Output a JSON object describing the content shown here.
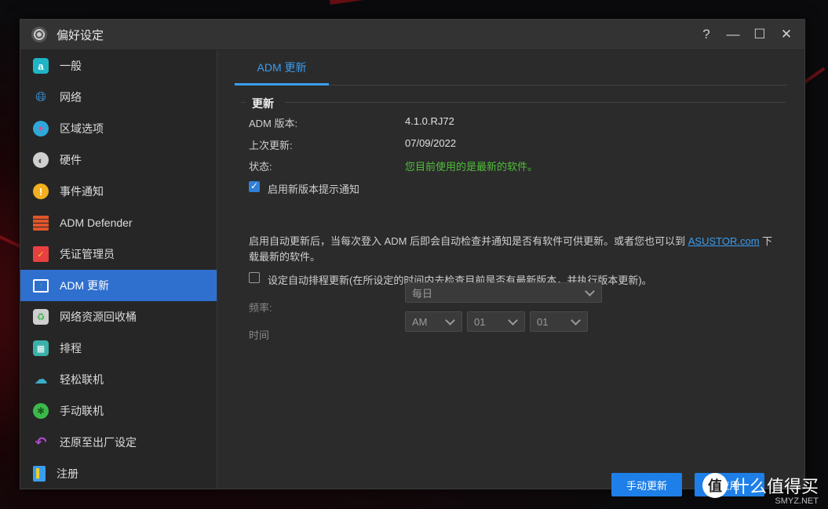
{
  "window": {
    "title": "偏好设定"
  },
  "controls": {
    "help": "?",
    "minimize": "—",
    "maximize": "☐",
    "close": "✕"
  },
  "sidebar": {
    "items": [
      {
        "label": "一般",
        "icon": "general-icon",
        "color": "#1fb5c7"
      },
      {
        "label": "网络",
        "icon": "globe-icon",
        "color": "#3a9ef0"
      },
      {
        "label": "区域选项",
        "icon": "region-globe-icon",
        "color": "#2ea8d8"
      },
      {
        "label": "硬件",
        "icon": "hardware-icon",
        "color": "#cfcfcf"
      },
      {
        "label": "事件通知",
        "icon": "alert-icon",
        "color": "#f2b01e"
      },
      {
        "label": "ADM Defender",
        "icon": "firewall-icon",
        "color": "#e2552a"
      },
      {
        "label": "凭证管理员",
        "icon": "certificate-icon",
        "color": "#e84040"
      },
      {
        "label": "ADM 更新",
        "icon": "update-monitor-icon",
        "color": "#ffffff"
      },
      {
        "label": "网络资源回收桶",
        "icon": "recycle-bin-icon",
        "color": "#cfcfcf"
      },
      {
        "label": "排程",
        "icon": "calendar-icon",
        "color": "#3ab0a8"
      },
      {
        "label": "轻松联机",
        "icon": "cloud-upload-icon",
        "color": "#3ab0c8"
      },
      {
        "label": "手动联机",
        "icon": "manual-connect-icon",
        "color": "#3cb84a"
      },
      {
        "label": "还原至出厂设定",
        "icon": "restore-icon",
        "color": "#b04ad0"
      },
      {
        "label": "注册",
        "icon": "register-icon",
        "color": "#3a9ef0"
      }
    ],
    "active_index": 7
  },
  "main": {
    "tab": "ADM 更新",
    "section": "更新",
    "info": [
      {
        "label": "ADM 版本:",
        "value": "4.1.0.RJ72"
      },
      {
        "label": "上次更新:",
        "value": "07/09/2022"
      },
      {
        "label": "状态:",
        "value": "您目前使用的是最新的软件。"
      }
    ],
    "notify_checkbox": {
      "label": "启用新版本提示通知",
      "checked": true
    },
    "desc_pre": "启用自动更新后，当每次登入 ADM 后即会自动检查并通知是否有软件可供更新。或者您也可以到",
    "desc_link": "ASUSTOR.com",
    "desc_post": "下载最新的软件。",
    "schedule_checkbox": {
      "label": "设定自动排程更新(在所设定的时间内去检查目前是否有最新版本，并执行版本更新)。",
      "checked": false
    },
    "frequency": {
      "label": "频率:",
      "value": "每日"
    },
    "time": {
      "label": "时间",
      "ampm": "AM",
      "hour": "01",
      "minute": "01"
    }
  },
  "buttons": {
    "manual_update": "手动更新",
    "apply": "应用"
  },
  "watermark": {
    "badge": "值",
    "text": "什么值得买",
    "sub": "SMYZ.NET"
  }
}
